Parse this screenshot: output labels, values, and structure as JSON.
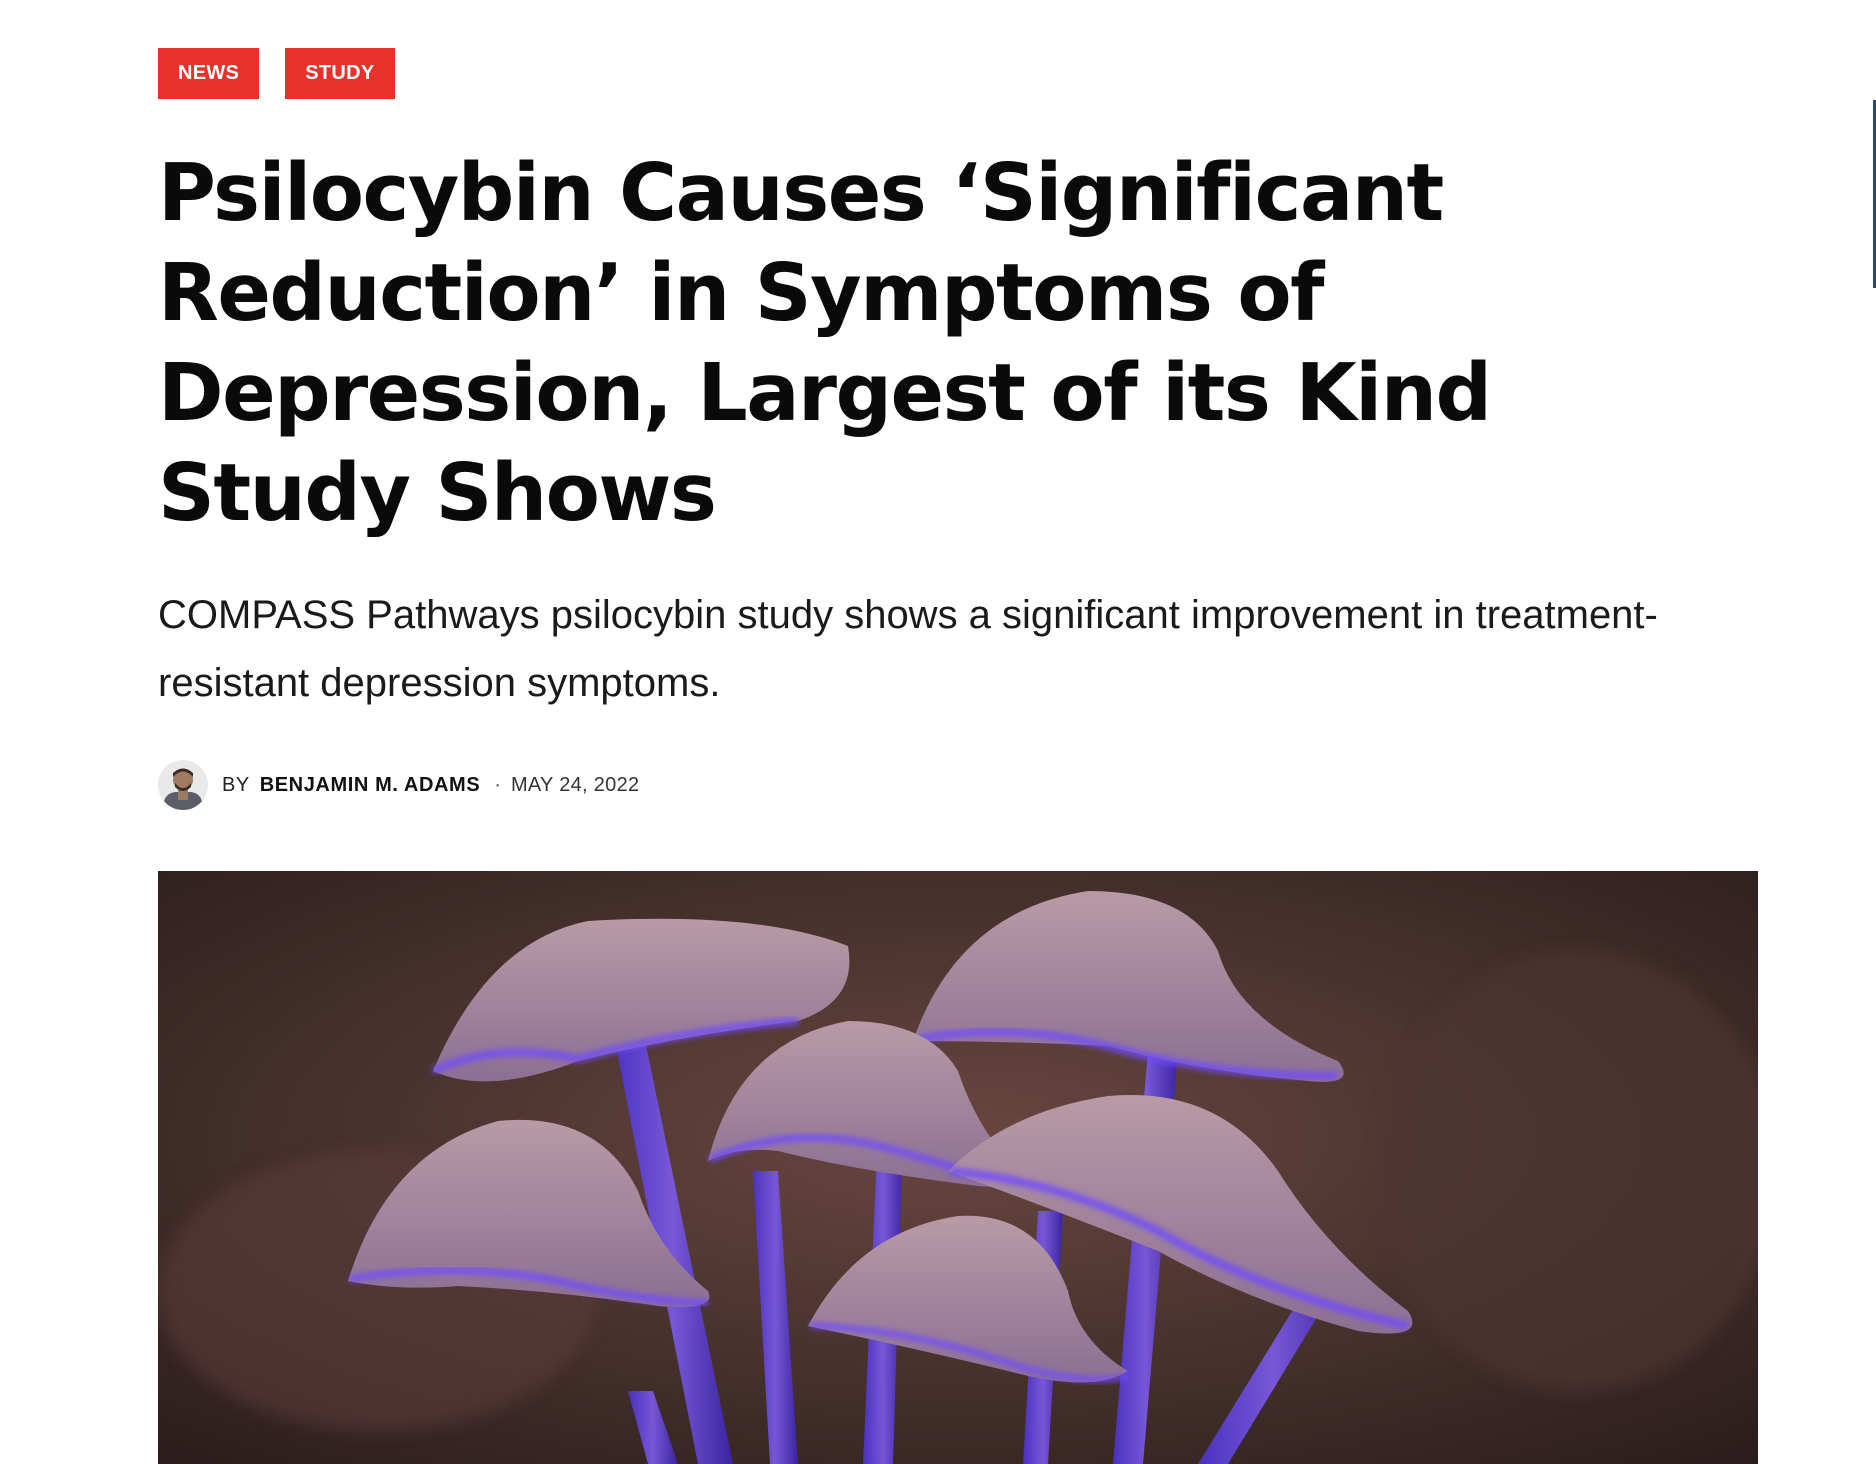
{
  "tags": [
    {
      "label": "NEWS"
    },
    {
      "label": "STUDY"
    }
  ],
  "article": {
    "title": "Psilocybin Causes ‘Significant Reduction’ in Symptoms of Depression, Largest of its Kind Study Shows",
    "subtitle": "COMPASS Pathways psilocybin study shows a significant improvement in treatment-resistant depression symptoms.",
    "byline": {
      "by_label": "BY",
      "author": "BENJAMIN M. ADAMS",
      "separator": "·",
      "date": "MAY 24, 2022"
    }
  },
  "colors": {
    "tag_background": "#e8312a",
    "tag_text": "#ffffff",
    "title_text": "#0a0a0a"
  },
  "icons": {
    "avatar": "author-avatar",
    "hero": "glowing-mushrooms-photo"
  }
}
